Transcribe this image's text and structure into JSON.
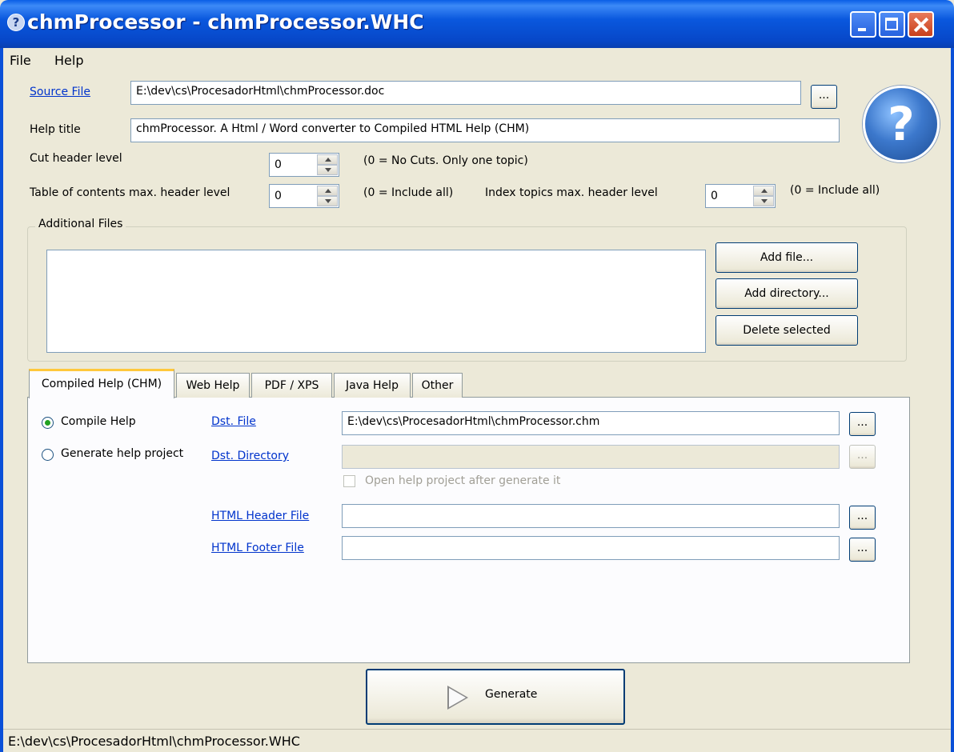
{
  "window": {
    "title": "chmProcessor - chmProcessor.WHC",
    "icon": "help-icon"
  },
  "menu": {
    "file": "File",
    "help": "Help"
  },
  "source": {
    "label": "Source File",
    "value": "E:\\dev\\cs\\ProcesadorHtml\\chmProcessor.doc",
    "browse": "..."
  },
  "help_title": {
    "label": "Help title",
    "value": "chmProcessor. A Html / Word converter to Compiled HTML Help (CHM)"
  },
  "cut_header": {
    "label": "Cut header level",
    "value": "0",
    "hint": "(0 = No Cuts. Only one topic)"
  },
  "toc_header": {
    "label": "Table of contents max. header level",
    "value": "0",
    "hint": "(0 = Include all)"
  },
  "index_header": {
    "label": "Index topics max. header level",
    "value": "0",
    "hint": "(0 = Include all)"
  },
  "additional_files": {
    "legend": "Additional Files",
    "add_file": "Add file...",
    "add_directory": "Add directory...",
    "delete_selected": "Delete selected"
  },
  "tabs": [
    "Compiled Help (CHM)",
    "Web Help",
    "PDF / XPS",
    "Java Help",
    "Other"
  ],
  "chm": {
    "compile_help": "Compile Help",
    "generate_project": "Generate help project",
    "dst_file_label": "Dst. File",
    "dst_file_value": "E:\\dev\\cs\\ProcesadorHtml\\chmProcessor.chm",
    "dst_dir_label": "Dst. Directory",
    "dst_dir_value": "",
    "open_project": "Open help project after generate it",
    "header_label": "HTML Header File",
    "header_value": "",
    "footer_label": "HTML Footer File",
    "footer_value": "",
    "browse": "..."
  },
  "generate": {
    "label": "Generate"
  },
  "status": {
    "text": "E:\\dev\\cs\\ProcesadorHtml\\chmProcessor.WHC"
  },
  "colors": {
    "title_bar": "#0a5ee6",
    "link": "#0033cc",
    "window_bg": "#ece9d8",
    "tab_highlight": "#ffc83c"
  }
}
